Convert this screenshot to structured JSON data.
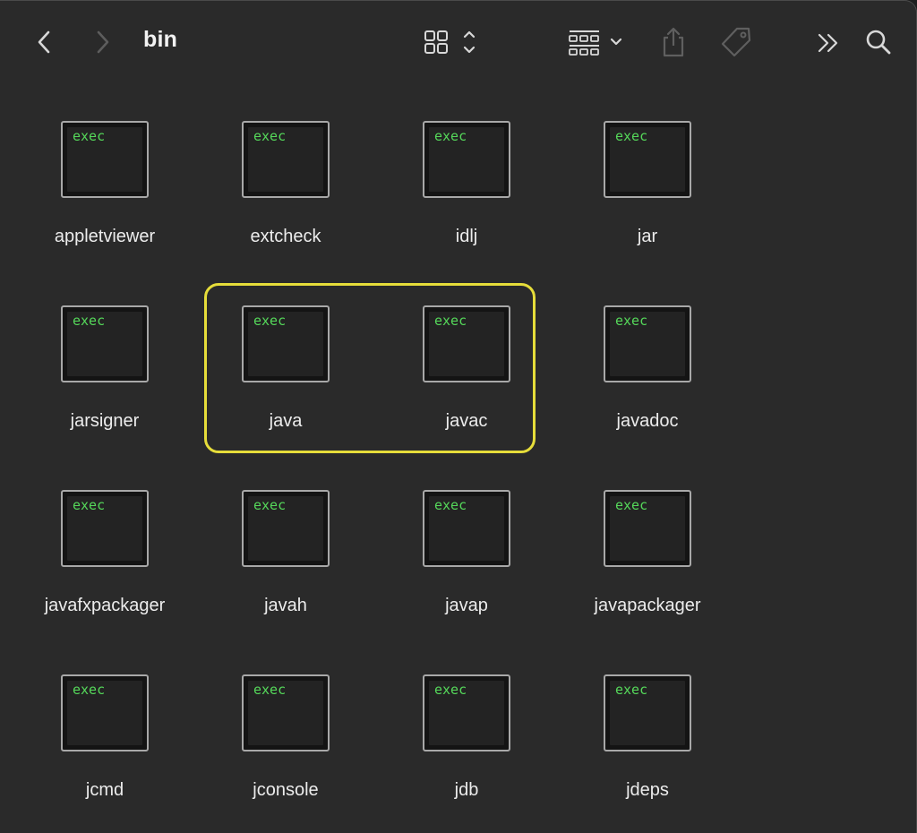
{
  "toolbar": {
    "title": "bin",
    "icons": {
      "back": "chevron-left-icon",
      "forward": "chevron-right-icon",
      "view": "icon-view-grid-icon",
      "group": "group-by-icon",
      "share": "share-icon",
      "tag": "tag-icon",
      "more": "double-chevron-right-icon",
      "search": "search-icon"
    }
  },
  "files": [
    {
      "name": "appletviewer",
      "badge": "exec"
    },
    {
      "name": "extcheck",
      "badge": "exec"
    },
    {
      "name": "idlj",
      "badge": "exec"
    },
    {
      "name": "jar",
      "badge": "exec"
    },
    {
      "name": "jarsigner",
      "badge": "exec"
    },
    {
      "name": "java",
      "badge": "exec"
    },
    {
      "name": "javac",
      "badge": "exec"
    },
    {
      "name": "javadoc",
      "badge": "exec"
    },
    {
      "name": "javafxpackager",
      "badge": "exec"
    },
    {
      "name": "javah",
      "badge": "exec"
    },
    {
      "name": "javap",
      "badge": "exec"
    },
    {
      "name": "javapackager",
      "badge": "exec"
    },
    {
      "name": "jcmd",
      "badge": "exec"
    },
    {
      "name": "jconsole",
      "badge": "exec"
    },
    {
      "name": "jdb",
      "badge": "exec"
    },
    {
      "name": "jdeps",
      "badge": "exec"
    }
  ],
  "highlight": {
    "items": [
      "java",
      "javac"
    ],
    "color": "#e6dd3a"
  },
  "colors": {
    "background": "#2a2a2a",
    "exec_text": "#55d85a",
    "text": "#ececec"
  }
}
